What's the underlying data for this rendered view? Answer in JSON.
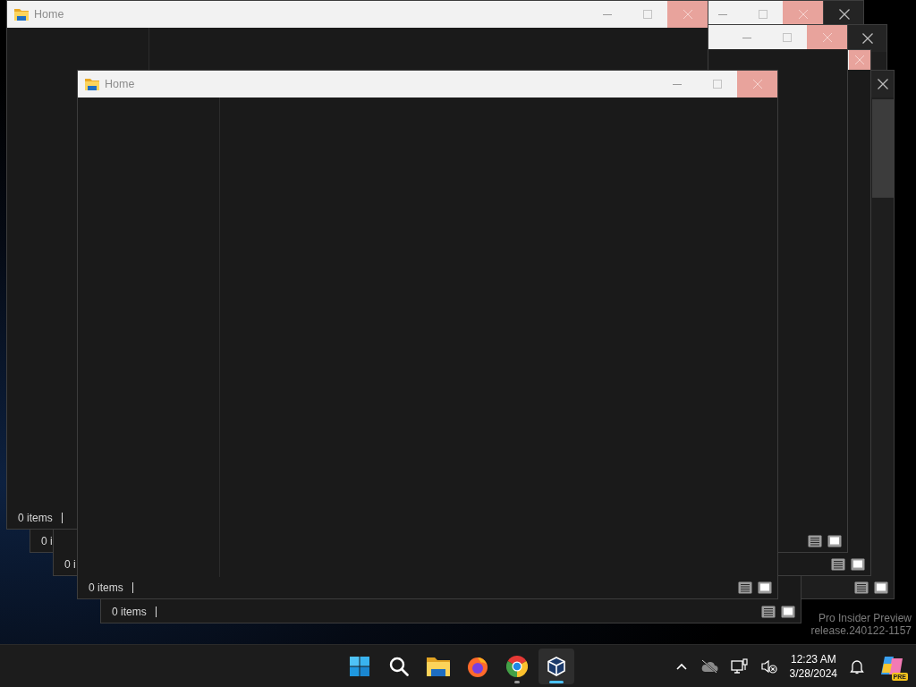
{
  "windows": [
    {
      "kind": "dark"
    },
    {
      "kind": "dark"
    },
    {
      "kind": "dark"
    },
    {
      "kind": "light",
      "status": "0 items"
    },
    {
      "kind": "light"
    },
    {
      "kind": "light"
    },
    {
      "kind": "light"
    },
    {
      "kind": "light",
      "status": "0 i"
    },
    {
      "kind": "light",
      "status": "0 i"
    },
    {
      "kind": "light",
      "title": "Home",
      "status": "0 items"
    },
    {
      "kind": "light",
      "title": "Home",
      "status": "0 items"
    }
  ],
  "desktop": {
    "build_lines": [
      "Pro Insider Preview",
      "release.240122-1157"
    ]
  },
  "taskbar": {
    "apps": [
      {
        "kind": "start",
        "running": false,
        "selected": false
      },
      {
        "kind": "search",
        "running": false,
        "selected": false
      },
      {
        "kind": "folder",
        "running": false,
        "selected": false
      },
      {
        "kind": "flame",
        "running": false,
        "selected": false
      },
      {
        "kind": "wheel",
        "running": true,
        "selected": false
      },
      {
        "kind": "cube",
        "running": true,
        "selected": true
      }
    ],
    "clock": {
      "time": "12:23 AM",
      "date": "3/28/2024"
    },
    "app_badge": "PRE"
  }
}
